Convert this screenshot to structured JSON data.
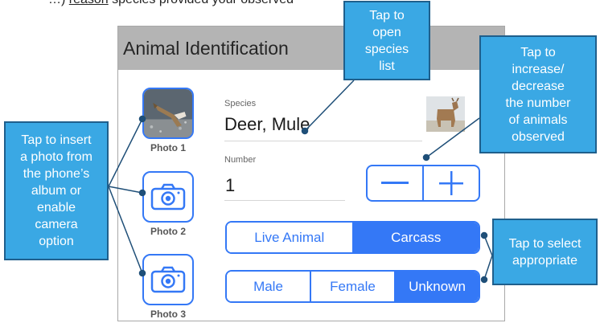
{
  "intro_text": {
    "before": "…) ",
    "underlined": "reason",
    "after": " species provided your observed"
  },
  "app": {
    "title": "Animal Identification"
  },
  "photos": [
    {
      "label": "Photo 1",
      "icon": "deer-photo-thumbnail"
    },
    {
      "label": "Photo 2",
      "icon": "camera-icon"
    },
    {
      "label": "Photo 3",
      "icon": "camera-icon"
    }
  ],
  "species": {
    "label": "Species",
    "value": "Deer, Mule",
    "icon": "deer-thumbnail"
  },
  "number": {
    "label": "Number",
    "value": "1",
    "decrement_icon": "minus-icon",
    "increment_icon": "plus-icon"
  },
  "status_segment": {
    "options": [
      "Live Animal",
      "Carcass"
    ],
    "selected": "Carcass"
  },
  "sex_segment": {
    "options": [
      "Male",
      "Female",
      "Unknown"
    ],
    "selected": "Unknown"
  },
  "callouts": {
    "species_list": [
      "Tap to",
      "open",
      "species",
      "list"
    ],
    "number": [
      "Tap to",
      "increase/",
      "decrease",
      "the number",
      "of animals",
      "observed"
    ],
    "photo": [
      "Tap to insert",
      "a photo from",
      "the phone’s",
      "album or",
      "enable",
      "camera",
      "option"
    ],
    "select": [
      "Tap to select",
      "appropriate"
    ]
  },
  "colors": {
    "accent": "#3478f6",
    "callout_fill": "#3aa8e4",
    "callout_border": "#1f5f8c",
    "header_bg": "#b4b4b4"
  }
}
